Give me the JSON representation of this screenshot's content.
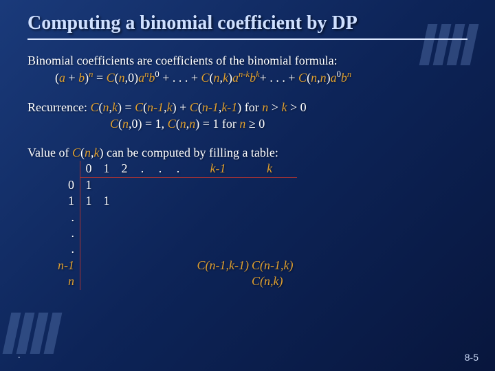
{
  "title": "Computing a binomial coefficient by DP",
  "intro": "Binomial coefficients are coefficients of the binomial formula:",
  "formula": {
    "lhs_open": "(",
    "a": "a",
    "plus": " + ",
    "b": "b",
    "close_paren": ")",
    "n": "n",
    "eq": " = ",
    "C": "C",
    "open": "(",
    "comma": ",",
    "zero": "0",
    "k": "k",
    "nk": "n-k",
    "dots": " + . . . + ",
    "plus2": "+ . . . + ",
    "closep": ")"
  },
  "recur_label": "Recurrence: ",
  "recur1_pref": "C",
  "recur1_args": "(",
  "n_var": "n",
  "k_var": "k",
  "nm1": "n-1",
  "km1": "k-1",
  "for_label": "  for  ",
  "cond1": " > 0",
  "gt": " > ",
  "recur2_c": "C",
  "eq1": " = 1,   ",
  "eq1b": " = 1  for ",
  "ge": " ≥ 0",
  "valueline": "Value of ",
  "valueline2": " can be computed by filling a table:",
  "table": {
    "cols": [
      "0",
      "1",
      "2",
      ".",
      ".",
      ".",
      "k-1",
      "k"
    ],
    "rows": [
      "0",
      "1",
      ".",
      ".",
      ".",
      "n-1",
      "n"
    ],
    "r0": [
      "1",
      "",
      "",
      "",
      "",
      "",
      "",
      ""
    ],
    "r1": [
      "1",
      "1",
      "",
      "",
      "",
      "",
      "",
      ""
    ],
    "cellA": "C(n-1,k-1)",
    "cellB": "C(n-1,k)",
    "cellC": "C(n,k)"
  },
  "pagenum": "8-5",
  "footerdot": "."
}
